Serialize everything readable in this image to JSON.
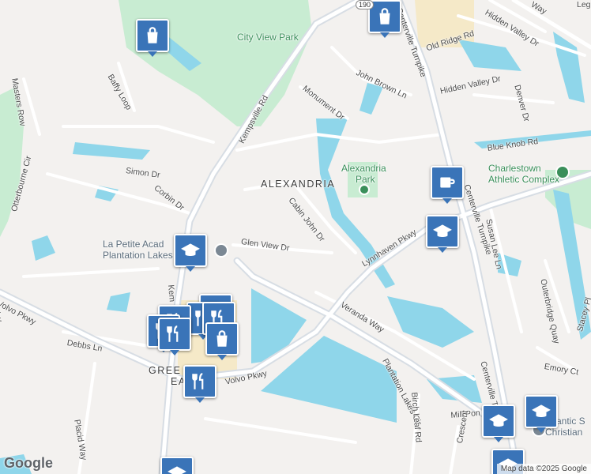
{
  "map": {
    "colors": {
      "land": "#f3f1ef",
      "water": "#8fd6ea",
      "park": "#c8ecd2",
      "road": "#ffffff",
      "major_road": "#d7dde4",
      "pin": "#3a74b8"
    },
    "area_label": "ALEXANDRIA",
    "parks": [
      {
        "id": "city-view-park",
        "name": "City View Park"
      },
      {
        "id": "alexandria-park",
        "name": "Alexandria Park"
      }
    ],
    "poi_labels": [
      {
        "id": "charlestown",
        "name": "Charlestown Athletic Complex",
        "line1": "Charlestown",
        "line2": "Athletic Complex"
      },
      {
        "id": "la-petite",
        "name": "La Petite Academy of Plantation Lakes",
        "line1": "La Petite Acad",
        "line2": "Plantation Lakes"
      },
      {
        "id": "greenbrier",
        "name": "GREENBRIER EAST",
        "line1": "GREE",
        "line2": "EA"
      },
      {
        "id": "atlantic",
        "name": "Atlantic Shores Christian",
        "line1": "Atlantic S",
        "line2": "Christian"
      }
    ],
    "streets": [
      {
        "id": "kempsville-rd",
        "name": "Kempsville Rd"
      },
      {
        "id": "kempsville-rd-south",
        "name": "Kem"
      },
      {
        "id": "centerville-tpke",
        "name": "Centerville Turnpike"
      },
      {
        "id": "centerville-tpke-south",
        "name": "Centerville Turnpike"
      },
      {
        "id": "centerville-tpke-north",
        "name": "Centerville Turnpike"
      },
      {
        "id": "volvo-pkwy-west",
        "name": "Volvo Pkwy"
      },
      {
        "id": "volvo-pkwy-east",
        "name": "Volvo Pkwy"
      },
      {
        "id": "lynnhaven-pkwy",
        "name": "Lynnhaven Pkwy"
      },
      {
        "id": "glen-view-dr",
        "name": "Glen View Dr"
      },
      {
        "id": "cabin-john-dr",
        "name": "Cabin John Dr"
      },
      {
        "id": "veranda-way",
        "name": "Veranda Way"
      },
      {
        "id": "plantation-lakes-cir",
        "name": "Plantation Lakes Cir"
      },
      {
        "id": "birch-leaf-rd",
        "name": "Birch Leaf Rd"
      },
      {
        "id": "simon-dr",
        "name": "Simon Dr"
      },
      {
        "id": "corbin-dr",
        "name": "Corbin Dr"
      },
      {
        "id": "baffy-loop",
        "name": "Baffy Loop"
      },
      {
        "id": "masters-row",
        "name": "Masters Row"
      },
      {
        "id": "otterbourne-cir",
        "name": "Otterbourne Cir"
      },
      {
        "id": "debbs-ln",
        "name": "Debbs Ln"
      },
      {
        "id": "placid-way",
        "name": "Placid Way"
      },
      {
        "id": "monument-dr",
        "name": "Monument Dr"
      },
      {
        "id": "john-brown-ln",
        "name": "John Brown Ln"
      },
      {
        "id": "old-ridge-rd",
        "name": "Old Ridge Rd"
      },
      {
        "id": "hidden-valley-dr-n",
        "name": "Hidden Valley Dr"
      },
      {
        "id": "hidden-valley-dr-s",
        "name": "Hidden Valley Dr"
      },
      {
        "id": "denver-dr",
        "name": "Denver Dr"
      },
      {
        "id": "blue-knob-rd",
        "name": "Blue Knob Rd"
      },
      {
        "id": "susan-lee-ln",
        "name": "Susan Lee Ln"
      },
      {
        "id": "outerbridge-quay",
        "name": "Outerbridge Quay"
      },
      {
        "id": "stacey-pl",
        "name": "Stacey Pl"
      },
      {
        "id": "emory-ct",
        "name": "Emory Ct"
      },
      {
        "id": "mill-pond",
        "name": "Mill Pon"
      },
      {
        "id": "crescent",
        "name": "Crescent"
      },
      {
        "id": "leg",
        "name": "Leg"
      },
      {
        "id": "way-ne",
        "name": "Way"
      },
      {
        "id": "plaza-w",
        "name": "Way"
      }
    ],
    "route_shield": "190",
    "markers": [
      {
        "id": "shopping-nw",
        "type": "shopping"
      },
      {
        "id": "shopping-top",
        "type": "shopping"
      },
      {
        "id": "coffee",
        "type": "coffee"
      },
      {
        "id": "school-lynnhaven",
        "type": "school"
      },
      {
        "id": "school-la-petite",
        "type": "school"
      },
      {
        "id": "restaurant-1",
        "type": "restaurant"
      },
      {
        "id": "restaurant-2",
        "type": "restaurant"
      },
      {
        "id": "restaurant-3",
        "type": "restaurant"
      },
      {
        "id": "restaurant-4",
        "type": "restaurant"
      },
      {
        "id": "restaurant-5",
        "type": "restaurant"
      },
      {
        "id": "restaurant-6",
        "type": "restaurant"
      },
      {
        "id": "shopping-greenbrier",
        "type": "shopping"
      },
      {
        "id": "restaurant-7",
        "type": "restaurant"
      },
      {
        "id": "school-atlantic-1",
        "type": "school"
      },
      {
        "id": "school-atlantic-2",
        "type": "school"
      },
      {
        "id": "school-south",
        "type": "school"
      },
      {
        "id": "school-bottom",
        "type": "school"
      }
    ],
    "logo": "Google",
    "attribution": "Map data ©2025 Google"
  }
}
